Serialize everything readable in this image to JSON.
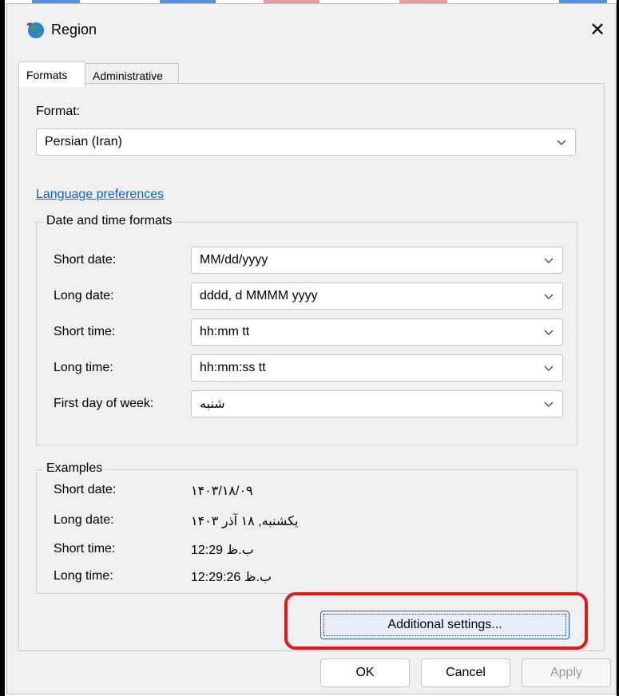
{
  "window": {
    "title": "Region",
    "close_glyph": "✕"
  },
  "tabs": [
    {
      "label": "Formats"
    },
    {
      "label": "Administrative"
    }
  ],
  "format": {
    "label": "Format:",
    "value": "Persian (Iran)"
  },
  "language_link": "Language preferences",
  "date_time": {
    "title": "Date and time formats",
    "rows": [
      {
        "label": "Short date:",
        "value": "MM/dd/yyyy"
      },
      {
        "label": "Long date:",
        "value": "dddd, d MMMM yyyy"
      },
      {
        "label": "Short time:",
        "value": "hh:mm tt"
      },
      {
        "label": "Long time:",
        "value": "hh:mm:ss tt"
      },
      {
        "label": "First day of week:",
        "value": "شنبه"
      }
    ]
  },
  "examples": {
    "title": "Examples",
    "rows": [
      {
        "label": "Short date:",
        "value": "۱۴۰۳/۱۸/۰۹"
      },
      {
        "label": "Long date:",
        "value": "یکشنبه, ۱۸ آذر ۱۴۰۳"
      },
      {
        "label": "Short time:",
        "value": "12:29 ب.ظ"
      },
      {
        "label": "Long time:",
        "value": "12:29:26 ب.ظ"
      }
    ]
  },
  "buttons": {
    "additional": "Additional settings...",
    "ok": "OK",
    "cancel": "Cancel",
    "apply": "Apply"
  },
  "colors": {
    "highlight": "#e01818",
    "link": "#0a66c8",
    "focus": "#1e66c8"
  },
  "icons": {
    "app": "globe-icon",
    "dropdown": "chevron-down-icon",
    "close": "close-icon"
  }
}
